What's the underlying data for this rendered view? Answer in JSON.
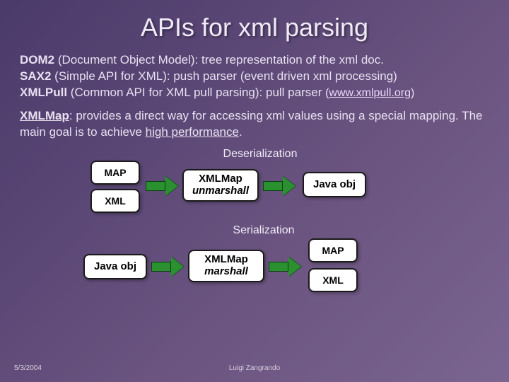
{
  "title": "APIs for xml parsing",
  "apis": {
    "dom2": {
      "name": "DOM2",
      "full": "(Document Object Model)",
      "desc": ": tree representation of the xml doc."
    },
    "sax2": {
      "name": "SAX2",
      "full": "(Simple API for XML)",
      "desc": ": push parser (event driven xml processing)"
    },
    "xmlpull": {
      "name": "XMLPull",
      "full": "(Common API for XML pull parsing)",
      "desc": ": pull parser "
    },
    "xmlpull_link_open": "(",
    "xmlpull_link": "www.xmlpull.org",
    "xmlpull_link_close": ")"
  },
  "xmlmap": {
    "name": "XMLMap",
    "text1": ": provides a direct way for accessing xml values using a special mapping. The main goal is to achieve ",
    "emph": "high performance",
    "text2": "."
  },
  "diagram": {
    "deser_label": "Deserialization",
    "ser_label": "Serialization",
    "map": "MAP",
    "xml": "XML",
    "java_obj": "Java obj",
    "xmlmap": "XMLMap",
    "unmarshall": "unmarshall",
    "marshall": "marshall"
  },
  "footer": {
    "date": "5/3/2004",
    "author": "Luigi Zangrando"
  }
}
